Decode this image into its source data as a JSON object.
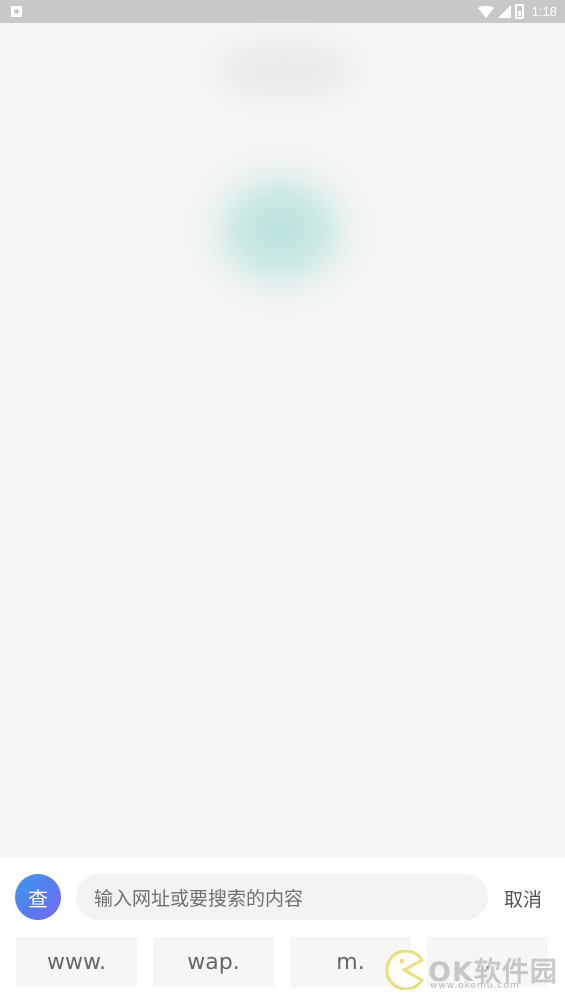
{
  "status_bar": {
    "time": "1:18",
    "left_icon": "notification-a-icon",
    "icons": [
      "wifi-icon",
      "signal-icon",
      "battery-icon"
    ],
    "background": "#c8c8c8"
  },
  "search": {
    "badge_label": "查",
    "placeholder": "输入网址或要搜索的内容",
    "cancel_label": "取消"
  },
  "prefixes": [
    "www.",
    "wap.",
    "m.",
    "."
  ],
  "watermark": {
    "main_text": "OK软件园",
    "sub_text": "www.okemu.com",
    "icon": "pacman-icon"
  },
  "colors": {
    "background": "#f7f7f7",
    "badge_gradient_start": "#3a9bf0",
    "badge_gradient_end": "#7d6cf2",
    "accent_blur": "#b7e2dc"
  }
}
